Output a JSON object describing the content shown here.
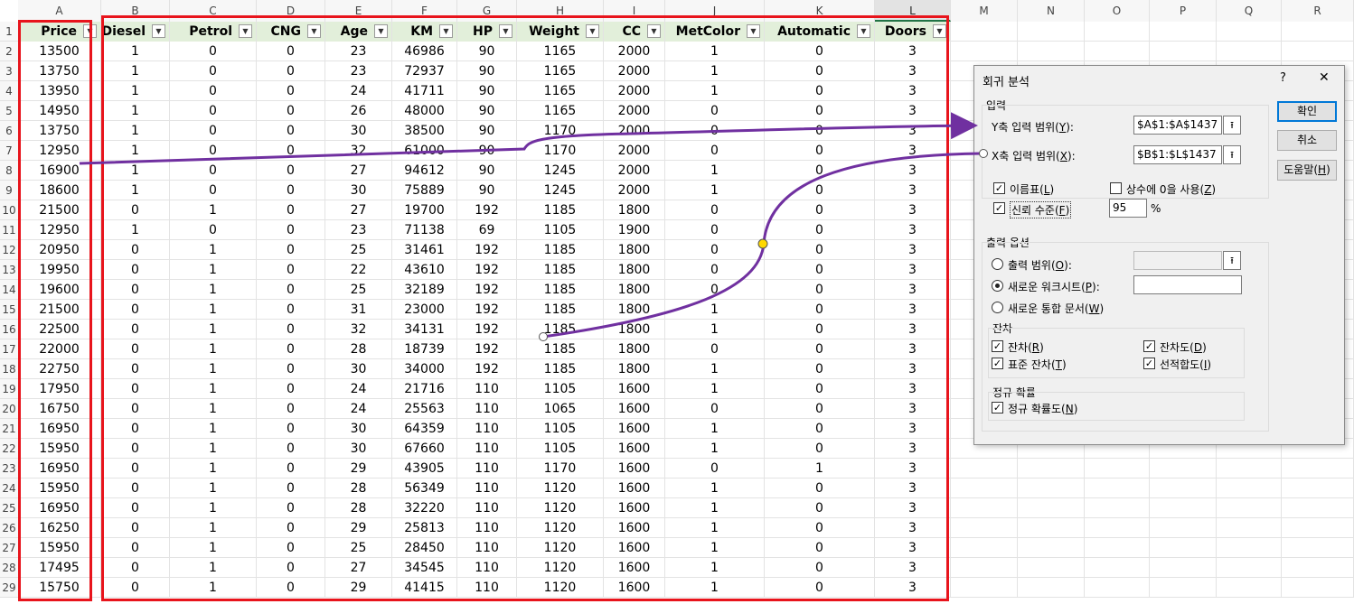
{
  "sheet": {
    "column_letters": [
      "A",
      "B",
      "C",
      "D",
      "E",
      "F",
      "G",
      "H",
      "I",
      "J",
      "K",
      "L",
      "M",
      "N",
      "O",
      "P",
      "Q",
      "R"
    ],
    "selected_column": "L",
    "row_numbers": [
      1,
      2,
      3,
      4,
      5,
      6,
      7,
      8,
      9,
      10,
      11,
      12,
      13,
      14,
      15,
      16,
      17,
      18,
      19,
      20,
      21,
      22,
      23,
      24,
      25,
      26,
      27,
      28,
      29
    ],
    "headers": [
      "Price",
      "Diesel",
      "Petrol",
      "CNG",
      "Age",
      "KM",
      "HP",
      "Weight",
      "CC",
      "MetColor",
      "Automatic",
      "Doors"
    ],
    "rows": [
      [
        13500,
        1,
        0,
        0,
        23,
        46986,
        90,
        1165,
        2000,
        1,
        0,
        3
      ],
      [
        13750,
        1,
        0,
        0,
        23,
        72937,
        90,
        1165,
        2000,
        1,
        0,
        3
      ],
      [
        13950,
        1,
        0,
        0,
        24,
        41711,
        90,
        1165,
        2000,
        1,
        0,
        3
      ],
      [
        14950,
        1,
        0,
        0,
        26,
        48000,
        90,
        1165,
        2000,
        0,
        0,
        3
      ],
      [
        13750,
        1,
        0,
        0,
        30,
        38500,
        90,
        1170,
        2000,
        0,
        0,
        3
      ],
      [
        12950,
        1,
        0,
        0,
        32,
        61000,
        90,
        1170,
        2000,
        0,
        0,
        3
      ],
      [
        16900,
        1,
        0,
        0,
        27,
        94612,
        90,
        1245,
        2000,
        1,
        0,
        3
      ],
      [
        18600,
        1,
        0,
        0,
        30,
        75889,
        90,
        1245,
        2000,
        1,
        0,
        3
      ],
      [
        21500,
        0,
        1,
        0,
        27,
        19700,
        192,
        1185,
        1800,
        0,
        0,
        3
      ],
      [
        12950,
        1,
        0,
        0,
        23,
        71138,
        69,
        1105,
        1900,
        0,
        0,
        3
      ],
      [
        20950,
        0,
        1,
        0,
        25,
        31461,
        192,
        1185,
        1800,
        0,
        0,
        3
      ],
      [
        19950,
        0,
        1,
        0,
        22,
        43610,
        192,
        1185,
        1800,
        0,
        0,
        3
      ],
      [
        19600,
        0,
        1,
        0,
        25,
        32189,
        192,
        1185,
        1800,
        0,
        0,
        3
      ],
      [
        21500,
        0,
        1,
        0,
        31,
        23000,
        192,
        1185,
        1800,
        1,
        0,
        3
      ],
      [
        22500,
        0,
        1,
        0,
        32,
        34131,
        192,
        1185,
        1800,
        1,
        0,
        3
      ],
      [
        22000,
        0,
        1,
        0,
        28,
        18739,
        192,
        1185,
        1800,
        0,
        0,
        3
      ],
      [
        22750,
        0,
        1,
        0,
        30,
        34000,
        192,
        1185,
        1800,
        1,
        0,
        3
      ],
      [
        17950,
        0,
        1,
        0,
        24,
        21716,
        110,
        1105,
        1600,
        1,
        0,
        3
      ],
      [
        16750,
        0,
        1,
        0,
        24,
        25563,
        110,
        1065,
        1600,
        0,
        0,
        3
      ],
      [
        16950,
        0,
        1,
        0,
        30,
        64359,
        110,
        1105,
        1600,
        1,
        0,
        3
      ],
      [
        15950,
        0,
        1,
        0,
        30,
        67660,
        110,
        1105,
        1600,
        1,
        0,
        3
      ],
      [
        16950,
        0,
        1,
        0,
        29,
        43905,
        110,
        1170,
        1600,
        0,
        1,
        3
      ],
      [
        15950,
        0,
        1,
        0,
        28,
        56349,
        110,
        1120,
        1600,
        1,
        0,
        3
      ],
      [
        16950,
        0,
        1,
        0,
        28,
        32220,
        110,
        1120,
        1600,
        1,
        0,
        3
      ],
      [
        16250,
        0,
        1,
        0,
        29,
        25813,
        110,
        1120,
        1600,
        1,
        0,
        3
      ],
      [
        15950,
        0,
        1,
        0,
        25,
        28450,
        110,
        1120,
        1600,
        1,
        0,
        3
      ],
      [
        17495,
        0,
        1,
        0,
        27,
        34545,
        110,
        1120,
        1600,
        1,
        0,
        3
      ],
      [
        15750,
        0,
        1,
        0,
        29,
        41415,
        110,
        1120,
        1600,
        1,
        0,
        3
      ]
    ],
    "filter_icon": "dropdown-arrow-icon"
  },
  "dialog": {
    "title": "회귀 분석",
    "help_glyph": "?",
    "close_glyph": "✕",
    "input_group": "입력",
    "y_range_label": "Y축 입력 범위(",
    "y_range_key": "Y",
    "y_range_value": "$A$1:$A$1437",
    "x_range_label": "X축 입력 범위(",
    "x_range_key": "X",
    "x_range_value": "$B$1:$L$1437",
    "labels_label": "이름표(",
    "labels_key": "L",
    "labels_checked": true,
    "constant_zero_label": "상수에 0을 사용(",
    "constant_zero_key": "Z",
    "constant_zero_checked": false,
    "confidence_label": "신뢰 수준(",
    "confidence_key": "F",
    "confidence_checked": true,
    "confidence_value": "95",
    "percent": "%",
    "output_group": "출력 옵션",
    "output_range_label": "출력 범위(",
    "output_range_key": "O",
    "new_sheet_label": "새로운 워크시트(",
    "new_sheet_key": "P",
    "new_sheet_selected": true,
    "new_workbook_label": "새로운 통합 문서(",
    "new_workbook_key": "W",
    "residuals_group": "잔차",
    "residuals_label": "잔차(",
    "residuals_key": "R",
    "std_residuals_label": "표준 잔차(",
    "std_residuals_key": "T",
    "residual_plots_label": "잔차도(",
    "residual_plots_key": "D",
    "line_fit_label": "선적합도(",
    "line_fit_key": "I",
    "normal_group": "정규 확률",
    "normal_plot_label": "정규 확률도(",
    "normal_plot_key": "N",
    "ok_button": "확인",
    "cancel_button": "취소",
    "help_button_prefix": "도움말(",
    "help_button_key": "H",
    "ref_icon": "collapse-range-icon",
    "close_paren": ")"
  },
  "annotations": {
    "highlight_color": "#e8141c",
    "arrow_color": "#7030a0",
    "handle_color": "#ffd800"
  }
}
